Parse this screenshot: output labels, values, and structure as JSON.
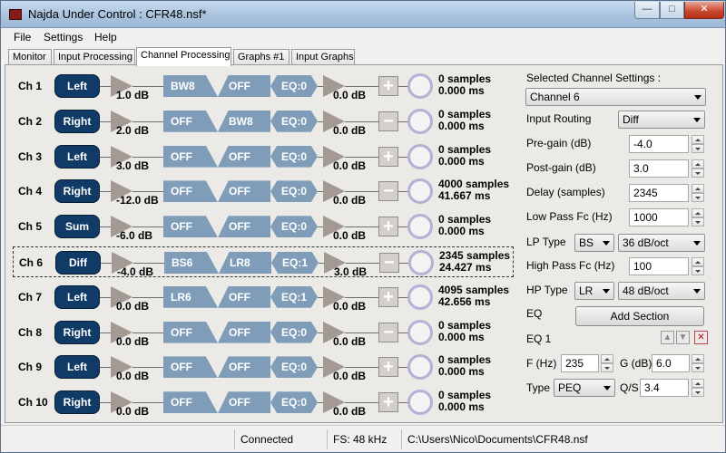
{
  "window": {
    "title": "Najda Under Control : CFR48.nsf*"
  },
  "menu": {
    "file": "File",
    "settings": "Settings",
    "help": "Help"
  },
  "tabs": [
    "Monitor",
    "Input Processing",
    "Channel Processing",
    "Graphs #1",
    "Input Graphs"
  ],
  "active_tab": "Channel Processing",
  "channels": [
    {
      "name": "Ch 1",
      "route": "Left",
      "pre_gain": "1.0 dB",
      "lowpass": "BW8",
      "highpass": "OFF",
      "eq": "EQ:0",
      "post_gain": "0.0 dB",
      "polarity": "+",
      "delay_samples": "0 samples",
      "delay_ms": "0.000 ms"
    },
    {
      "name": "Ch 2",
      "route": "Right",
      "pre_gain": "2.0 dB",
      "lowpass": "OFF",
      "highpass": "BW8",
      "eq": "EQ:0",
      "post_gain": "0.0 dB",
      "polarity": "−",
      "delay_samples": "0 samples",
      "delay_ms": "0.000 ms"
    },
    {
      "name": "Ch 3",
      "route": "Left",
      "pre_gain": "3.0 dB",
      "lowpass": "OFF",
      "highpass": "OFF",
      "eq": "EQ:0",
      "post_gain": "0.0 dB",
      "polarity": "+",
      "delay_samples": "0 samples",
      "delay_ms": "0.000 ms"
    },
    {
      "name": "Ch 4",
      "route": "Right",
      "pre_gain": "-12.0 dB",
      "lowpass": "OFF",
      "highpass": "OFF",
      "eq": "EQ:0",
      "post_gain": "0.0 dB",
      "polarity": "−",
      "delay_samples": "4000 samples",
      "delay_ms": "41.667 ms"
    },
    {
      "name": "Ch 5",
      "route": "Sum",
      "pre_gain": "-6.0 dB",
      "lowpass": "OFF",
      "highpass": "OFF",
      "eq": "EQ:0",
      "post_gain": "0.0 dB",
      "polarity": "+",
      "delay_samples": "0 samples",
      "delay_ms": "0.000 ms"
    },
    {
      "name": "Ch 6",
      "route": "Diff",
      "pre_gain": "-4.0 dB",
      "lowpass": "BS6",
      "highpass": "LR8",
      "eq": "EQ:1",
      "post_gain": "3.0 dB",
      "polarity": "−",
      "delay_samples": "2345 samples",
      "delay_ms": "24.427 ms"
    },
    {
      "name": "Ch 7",
      "route": "Left",
      "pre_gain": "0.0 dB",
      "lowpass": "LR6",
      "highpass": "OFF",
      "eq": "EQ:1",
      "post_gain": "0.0 dB",
      "polarity": "+",
      "delay_samples": "4095 samples",
      "delay_ms": "42.656 ms"
    },
    {
      "name": "Ch 8",
      "route": "Right",
      "pre_gain": "0.0 dB",
      "lowpass": "OFF",
      "highpass": "OFF",
      "eq": "EQ:0",
      "post_gain": "0.0 dB",
      "polarity": "−",
      "delay_samples": "0 samples",
      "delay_ms": "0.000 ms"
    },
    {
      "name": "Ch 9",
      "route": "Left",
      "pre_gain": "0.0 dB",
      "lowpass": "OFF",
      "highpass": "OFF",
      "eq": "EQ:0",
      "post_gain": "0.0 dB",
      "polarity": "+",
      "delay_samples": "0 samples",
      "delay_ms": "0.000 ms"
    },
    {
      "name": "Ch 10",
      "route": "Right",
      "pre_gain": "0.0 dB",
      "lowpass": "OFF",
      "highpass": "OFF",
      "eq": "EQ:0",
      "post_gain": "0.0 dB",
      "polarity": "+",
      "delay_samples": "0 samples",
      "delay_ms": "0.000 ms"
    }
  ],
  "selected_channel_index": 5,
  "settings": {
    "title": "Selected Channel Settings :",
    "channel_select": "Channel 6",
    "input_routing_label": "Input Routing",
    "input_routing": "Diff",
    "pre_gain_label": "Pre-gain (dB)",
    "pre_gain": "-4.0",
    "post_gain_label": "Post-gain (dB)",
    "post_gain": "3.0",
    "delay_label": "Delay (samples)",
    "delay": "2345",
    "lp_fc_label": "Low Pass Fc (Hz)",
    "lp_fc": "1000",
    "lp_type_label": "LP Type",
    "lp_type": "BS",
    "lp_slope": "36 dB/oct",
    "hp_fc_label": "High Pass Fc (Hz)",
    "hp_fc": "100",
    "hp_type_label": "HP Type",
    "hp_type": "LR",
    "hp_slope": "48 dB/oct",
    "eq_label": "EQ",
    "add_section_label": "Add Section",
    "eq_section_label": "EQ 1",
    "f_label": "F (Hz)",
    "f_value": "235",
    "g_label": "G (dB)",
    "g_value": "6.0",
    "type_label": "Type",
    "type_value": "PEQ",
    "q_label": "Q/S",
    "q_value": "3.4"
  },
  "status": {
    "connection": "Connected",
    "fs": "FS: 48 kHz",
    "path": "C:\\Users\\Nico\\Documents\\CFR48.nsf"
  },
  "colors": {
    "route_button": "#0f3b66",
    "filter_block": "#7f9db8",
    "amp": "#a39a93",
    "delay_ring": "#b5b0d6"
  }
}
